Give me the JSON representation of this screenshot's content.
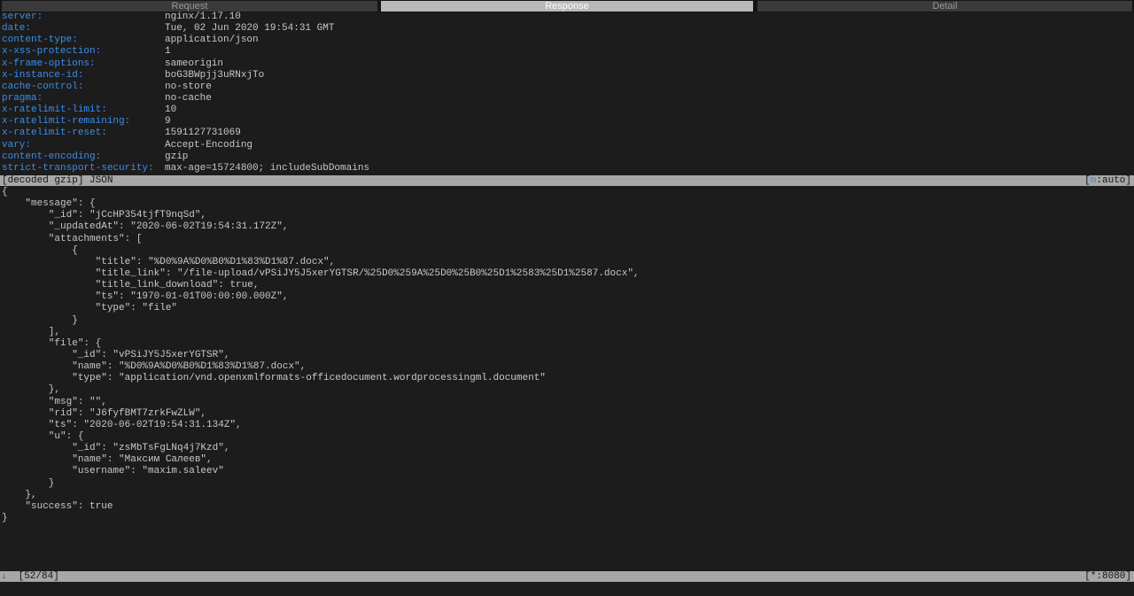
{
  "tabs": [
    {
      "label": "Request"
    },
    {
      "label": "Response"
    },
    {
      "label": "Detail"
    }
  ],
  "active_tab": "Response",
  "headers": [
    {
      "key": "server:",
      "value": "nginx/1.17.10"
    },
    {
      "key": "date:",
      "value": "Tue, 02 Jun 2020 19:54:31 GMT"
    },
    {
      "key": "content-type:",
      "value": "application/json"
    },
    {
      "key": "x-xss-protection:",
      "value": "1"
    },
    {
      "key": "x-frame-options:",
      "value": "sameorigin"
    },
    {
      "key": "x-instance-id:",
      "value": "boG3BWpjj3uRNxjTo"
    },
    {
      "key": "cache-control:",
      "value": "no-store"
    },
    {
      "key": "pragma:",
      "value": "no-cache"
    },
    {
      "key": "x-ratelimit-limit:",
      "value": "10"
    },
    {
      "key": "x-ratelimit-remaining:",
      "value": "9"
    },
    {
      "key": "x-ratelimit-reset:",
      "value": "1591127731069"
    },
    {
      "key": "vary:",
      "value": "Accept-Encoding"
    },
    {
      "key": "content-encoding:",
      "value": "gzip"
    },
    {
      "key": "strict-transport-security:",
      "value": "max-age=15724800; includeSubDomains"
    }
  ],
  "content_bar": {
    "left": "[decoded gzip] JSON",
    "right_open": "[",
    "right_key": "m",
    "right_rest": ":auto]"
  },
  "body_lines": [
    "{",
    "    \"message\": {",
    "        \"_id\": \"jCcHP354tjfT9nqSd\",",
    "        \"_updatedAt\": \"2020-06-02T19:54:31.172Z\",",
    "        \"attachments\": [",
    "            {",
    "                \"title\": \"%D0%9A%D0%B0%D1%83%D1%87.docx\",",
    "                \"title_link\": \"/file-upload/vPSiJY5J5xerYGTSR/%25D0%259A%25D0%25B0%25D1%2583%25D1%2587.docx\",",
    "                \"title_link_download\": true,",
    "                \"ts\": \"1970-01-01T00:00:00.000Z\",",
    "                \"type\": \"file\"",
    "            }",
    "        ],",
    "        \"file\": {",
    "            \"_id\": \"vPSiJY5J5xerYGTSR\",",
    "            \"name\": \"%D0%9A%D0%B0%D1%83%D1%87.docx\",",
    "            \"type\": \"application/vnd.openxmlformats-officedocument.wordprocessingml.document\"",
    "        },",
    "        \"msg\": \"\",",
    "        \"rid\": \"J6fyfBMT7zrkFwZLW\",",
    "        \"ts\": \"2020-06-02T19:54:31.134Z\",",
    "        \"u\": {",
    "            \"_id\": \"zsMbTsFgLNq4j7Kzd\",",
    "            \"name\": \"Максим Салеев\",",
    "            \"username\": \"maxim.saleev\"",
    "        }",
    "    },",
    "    \"success\": true",
    "}"
  ],
  "status_bar": {
    "arrow_icon": "↓",
    "position": "[52/84]",
    "right": "[*:8080]"
  },
  "icons": {
    "status_arrow": "down-arrow-icon"
  },
  "colors": {
    "header_key": "#3b8eea",
    "bar_bg": "#a7a7a7",
    "active_tab_bg": "#b9b9b9",
    "background": "#1c1c1c"
  }
}
